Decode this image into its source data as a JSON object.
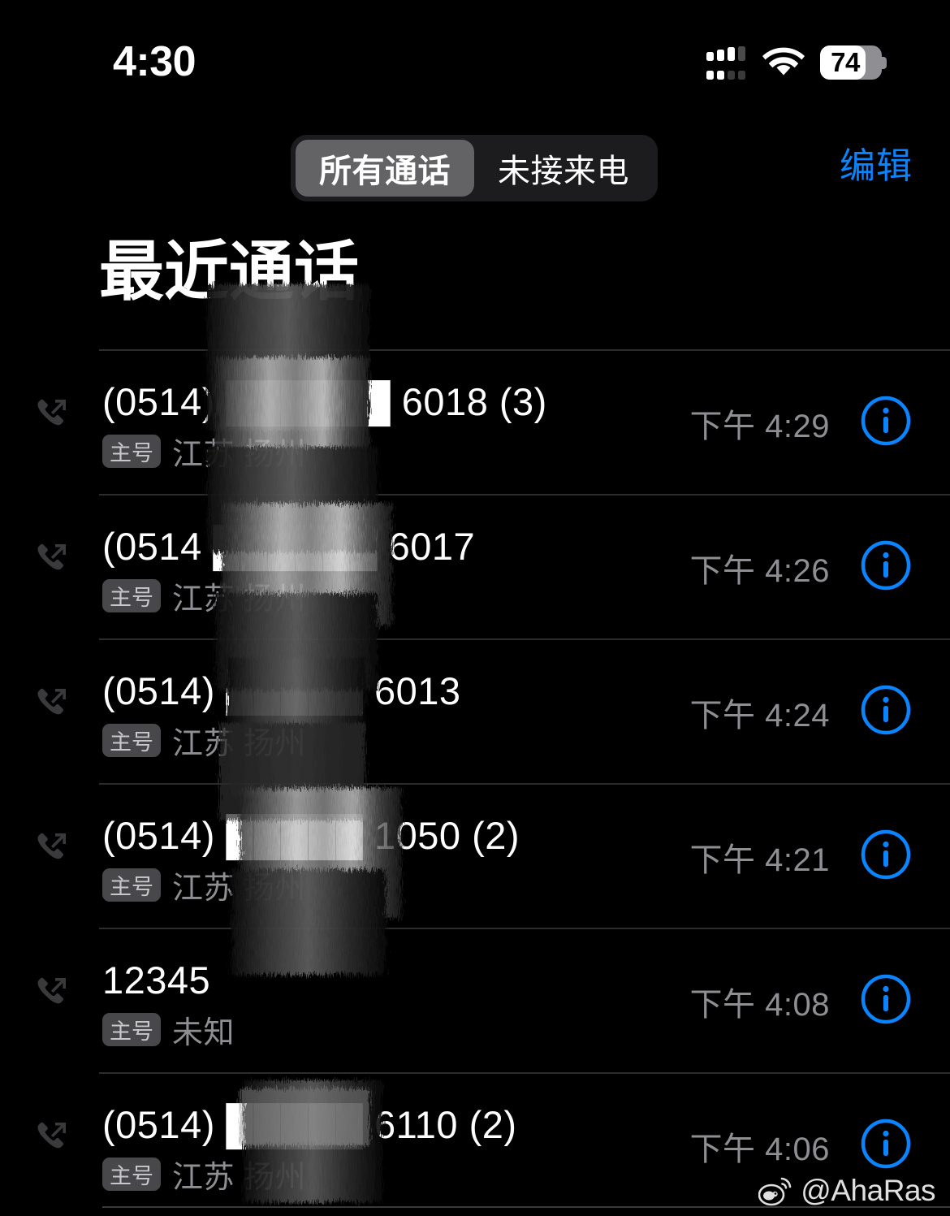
{
  "status_bar": {
    "time": "4:30",
    "battery_percent": "74",
    "signal_icon": "dual-sim-signal-bars-icon",
    "wifi_icon": "wifi-icon",
    "battery_icon": "battery-icon"
  },
  "top_bar": {
    "segments": [
      {
        "label": "所有通话",
        "selected": true
      },
      {
        "label": "未接来电",
        "selected": false
      }
    ],
    "edit_label": "编辑"
  },
  "page_title": "最近通话",
  "colors": {
    "accent_blue": "#0a84ff",
    "background": "#000000",
    "secondary_text": "#8e8e93",
    "segment_selected": "#636366",
    "segment_track": "#1c1c1e",
    "badge_background": "#48484a",
    "separator": "#2c2c2e"
  },
  "calls": [
    {
      "number": "(0514) ██████ 6018 (3)",
      "sim_badge": "主号",
      "location": "江苏 扬州",
      "time": "下午 4:29",
      "direction_icon": "outgoing-call-icon",
      "info_icon": "info-circle-icon",
      "redacted": true
    },
    {
      "number": "(0514 ██████ 6017",
      "sim_badge": "主号",
      "location": "江苏 扬州",
      "time": "下午 4:26",
      "direction_icon": "outgoing-call-icon",
      "info_icon": "info-circle-icon",
      "redacted": true
    },
    {
      "number": "(0514) █████ 6013",
      "sim_badge": "主号",
      "location": "江苏 扬州",
      "time": "下午 4:24",
      "direction_icon": "outgoing-call-icon",
      "info_icon": "info-circle-icon",
      "redacted": true
    },
    {
      "number": "(0514) █████ 1050 (2)",
      "sim_badge": "主号",
      "location": "江苏 扬州",
      "time": "下午 4:21",
      "direction_icon": "outgoing-call-icon",
      "info_icon": "info-circle-icon",
      "redacted": true
    },
    {
      "number": "12345",
      "sim_badge": "主号",
      "location": "未知",
      "time": "下午 4:08",
      "direction_icon": "outgoing-call-icon",
      "info_icon": "info-circle-icon",
      "redacted": false
    },
    {
      "number": "(0514) █████ 6110 (2)",
      "sim_badge": "主号",
      "location": "江苏 扬州",
      "time": "下午 4:06",
      "direction_icon": "outgoing-call-icon",
      "info_icon": "info-circle-icon",
      "redacted": true
    }
  ],
  "watermark": {
    "text": "@AhaRas",
    "logo_icon": "weibo-logo-icon"
  }
}
